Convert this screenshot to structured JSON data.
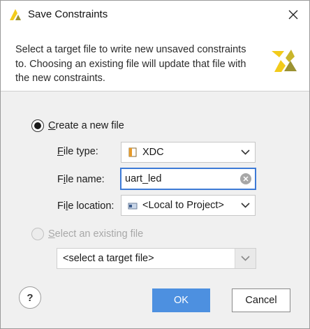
{
  "window": {
    "title": "Save Constraints",
    "logo_icon": "vivado-logo-icon",
    "close_icon": "close-icon"
  },
  "header": {
    "description": "Select a target file to write new unsaved constraints to. Choosing an existing file will update that file with the new constraints."
  },
  "create_new": {
    "label": "Create a new file",
    "selected": true,
    "file_type_label": "File type:",
    "file_type_value": "XDC",
    "file_type_icon": "xdc-file-icon",
    "file_name_label": "File name:",
    "file_name_value": "uart_led",
    "file_location_label": "File location:",
    "file_location_value": "<Local to Project>",
    "file_location_icon": "local-project-icon"
  },
  "select_existing": {
    "label": "Select an existing file",
    "selected": false,
    "enabled": false,
    "target_value": "<select a target file>"
  },
  "footer": {
    "help_label": "?",
    "ok_label": "OK",
    "cancel_label": "Cancel"
  },
  "colors": {
    "accent": "#4d90e0",
    "focus_border": "#3d7ad6",
    "dialog_bg": "#f0f0f0",
    "logo_yellow": "#f2cb1b",
    "logo_olive": "#9b9232"
  }
}
